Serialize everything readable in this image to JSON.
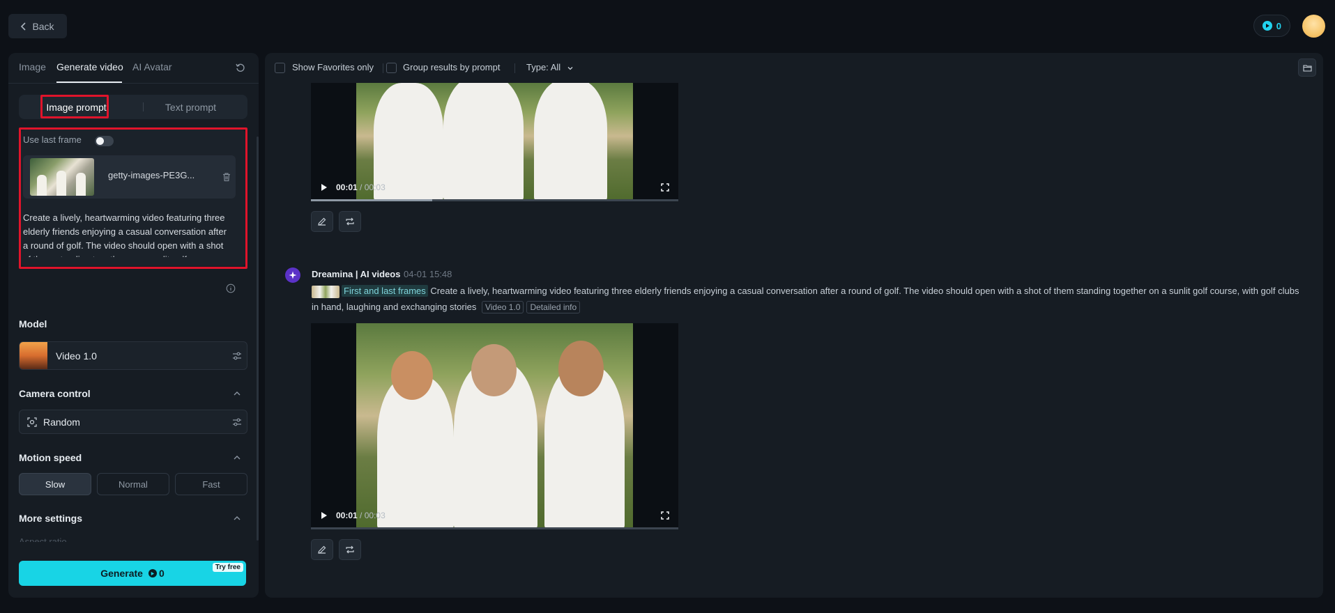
{
  "header": {
    "back_label": "Back",
    "credits": "0"
  },
  "left": {
    "tabs": [
      "Image",
      "Generate video",
      "AI Avatar"
    ],
    "segment": {
      "image_prompt": "Image prompt",
      "text_prompt": "Text prompt"
    },
    "use_last_frame": {
      "label": "Use last frame",
      "enabled": false
    },
    "file_name": "getty-images-PE3G...",
    "prompt_text": "Create a lively, heartwarming video featuring three elderly friends enjoying a casual conversation after a round of golf. The video should open with a shot of them standing together on a sunlit golf course, with golf clubs in hand, laughing and exchanging stories",
    "model": {
      "title": "Model",
      "value": "Video 1.0"
    },
    "camera": {
      "title": "Camera control",
      "value": "Random"
    },
    "motion": {
      "title": "Motion speed",
      "options": [
        "Slow",
        "Normal",
        "Fast"
      ],
      "selected": "Slow"
    },
    "more_settings": {
      "title": "More settings",
      "next_label": "Aspect ratio"
    },
    "generate": {
      "label": "Generate",
      "credits": "0",
      "badge": "Try free"
    }
  },
  "right": {
    "filters": {
      "favorites": "Show Favorites only",
      "group": "Group results by prompt",
      "type": "Type: All"
    },
    "video1": {
      "time_current": "00:01",
      "time_total": "/ 00:03",
      "progress": 0.33
    },
    "entry": {
      "bot_name": "Dreamina | AI videos",
      "date": "04-01  15:48",
      "frames_tag": "First and last frames",
      "prompt": "Create a lively, heartwarming video featuring three elderly friends enjoying a casual conversation after a round of golf. The video should open with a shot of them standing together on a sunlit golf course, with golf clubs in hand, laughing and exchanging stories",
      "tags": [
        "Video 1.0",
        "Detailed info"
      ]
    },
    "video2": {
      "time_current": "00:01",
      "time_total": "/ 00:03",
      "progress": 0.0
    }
  },
  "colors": {
    "accent": "#18d4e5",
    "highlight": "#e0142b",
    "bot": "#5b32c7"
  }
}
